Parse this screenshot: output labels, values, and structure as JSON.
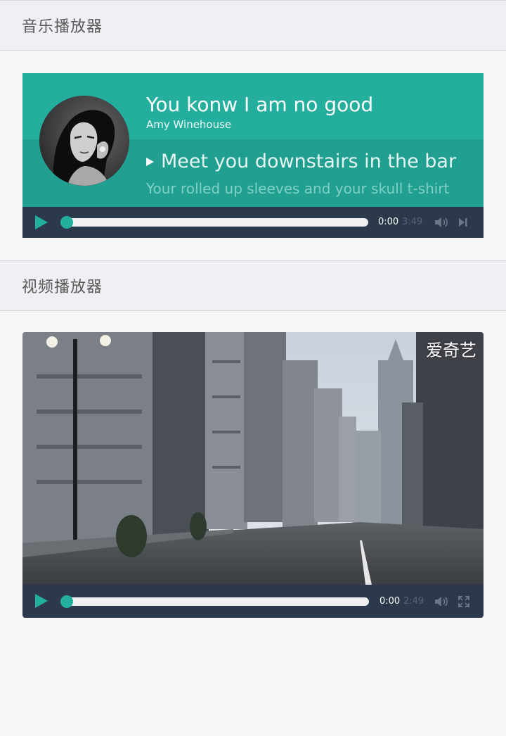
{
  "sections": {
    "music_header": "音乐播放器",
    "video_header": "视频播放器"
  },
  "music": {
    "title": "You konw I am no good",
    "artist": "Amy Winehouse",
    "lyric_current": "Meet you downstairs in the bar",
    "lyric_next": "Your rolled up sleeves and your skull t-shirt",
    "time_current": "0:00",
    "time_total": "3:49",
    "progress": 0,
    "icons": [
      "play-icon",
      "volume-icon",
      "next-track-icon"
    ]
  },
  "video": {
    "watermark": "爱奇艺",
    "time_current": "0:00",
    "time_total": "2:49",
    "progress": 0,
    "icons": [
      "play-icon",
      "volume-icon",
      "fullscreen-icon"
    ]
  },
  "colors": {
    "accent": "#24ae9e",
    "lyrics_band": "#219f90",
    "control_bar": "#2c394c",
    "page_background": "#f6f6f6",
    "header_background": "#efeff4"
  }
}
